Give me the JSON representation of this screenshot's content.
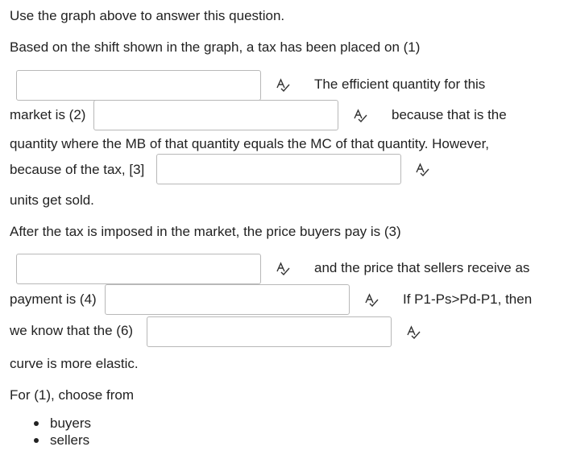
{
  "intro": "Use the graph above to answer this question.",
  "q1_lead": "Based on the shift shown in the graph, a tax has been placed on (1)",
  "q2_lead": "The efficient quantity for this",
  "q2_market": "market is (2)",
  "q2_tail": "because that is the",
  "q2_cont": "quantity where the MB of that quantity equals the MC of that quantity. However,",
  "q3_lead": "because of the tax, [3]",
  "q3_tail": "units get sold.",
  "q4_lead": "After the tax is imposed in the market, the price buyers pay is (3)",
  "q5_lead": "and the price that sellers receive as",
  "q5_payment": "payment is (4)",
  "q6_lead": "If P1-Ps>Pd-P1, then",
  "q6_know": "we know that the (6)",
  "q6_tail": "curve is more elastic.",
  "choose_label": "For (1), choose from",
  "options": [
    "buyers",
    "sellers"
  ],
  "answers": {
    "blank1": "",
    "blank2": "",
    "blank3": "",
    "blank4": "",
    "blank5": "",
    "blank6": ""
  }
}
